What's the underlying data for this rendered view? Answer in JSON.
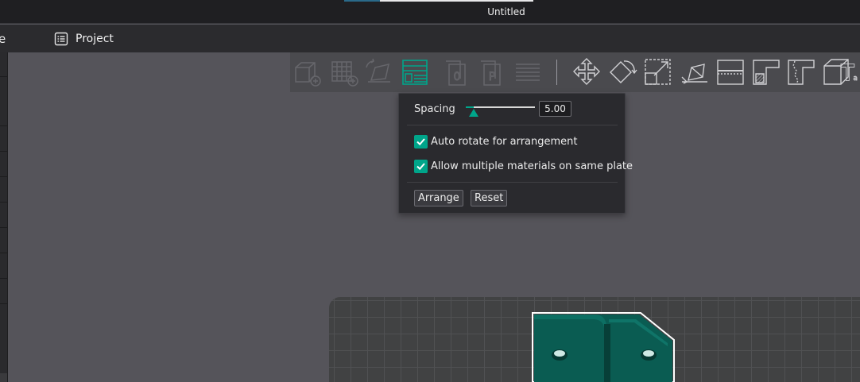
{
  "window": {
    "title": "Untitled"
  },
  "menubar": {
    "cut_item": "e",
    "project_label": "Project"
  },
  "toolbar": {
    "icons": [
      "add-cube-icon",
      "grid-add-icon",
      "auto-orient-icon",
      "arrange-icon",
      "plate-zero-icon",
      "plate-p-icon",
      "layers-icon",
      "move-icon",
      "rotate-icon",
      "scale-icon",
      "lay-on-face-icon",
      "cut-icon",
      "paint-support-icon",
      "seam-paint-icon",
      "measure-box-icon",
      "text-icon"
    ],
    "active": "arrange-icon"
  },
  "arrange_popup": {
    "spacing_label": "Spacing",
    "spacing_value": "5.00",
    "auto_rotate_label": "Auto rotate for arrangement",
    "auto_rotate_checked": true,
    "multi_material_label": "Allow multiple materials on same plate",
    "multi_material_checked": true,
    "arrange_button": "Arrange",
    "reset_button": "Reset"
  },
  "colors": {
    "accent": "#00a58a",
    "model": "#0a5c52",
    "background": "#55545a",
    "panel": "#2a2a2e"
  }
}
